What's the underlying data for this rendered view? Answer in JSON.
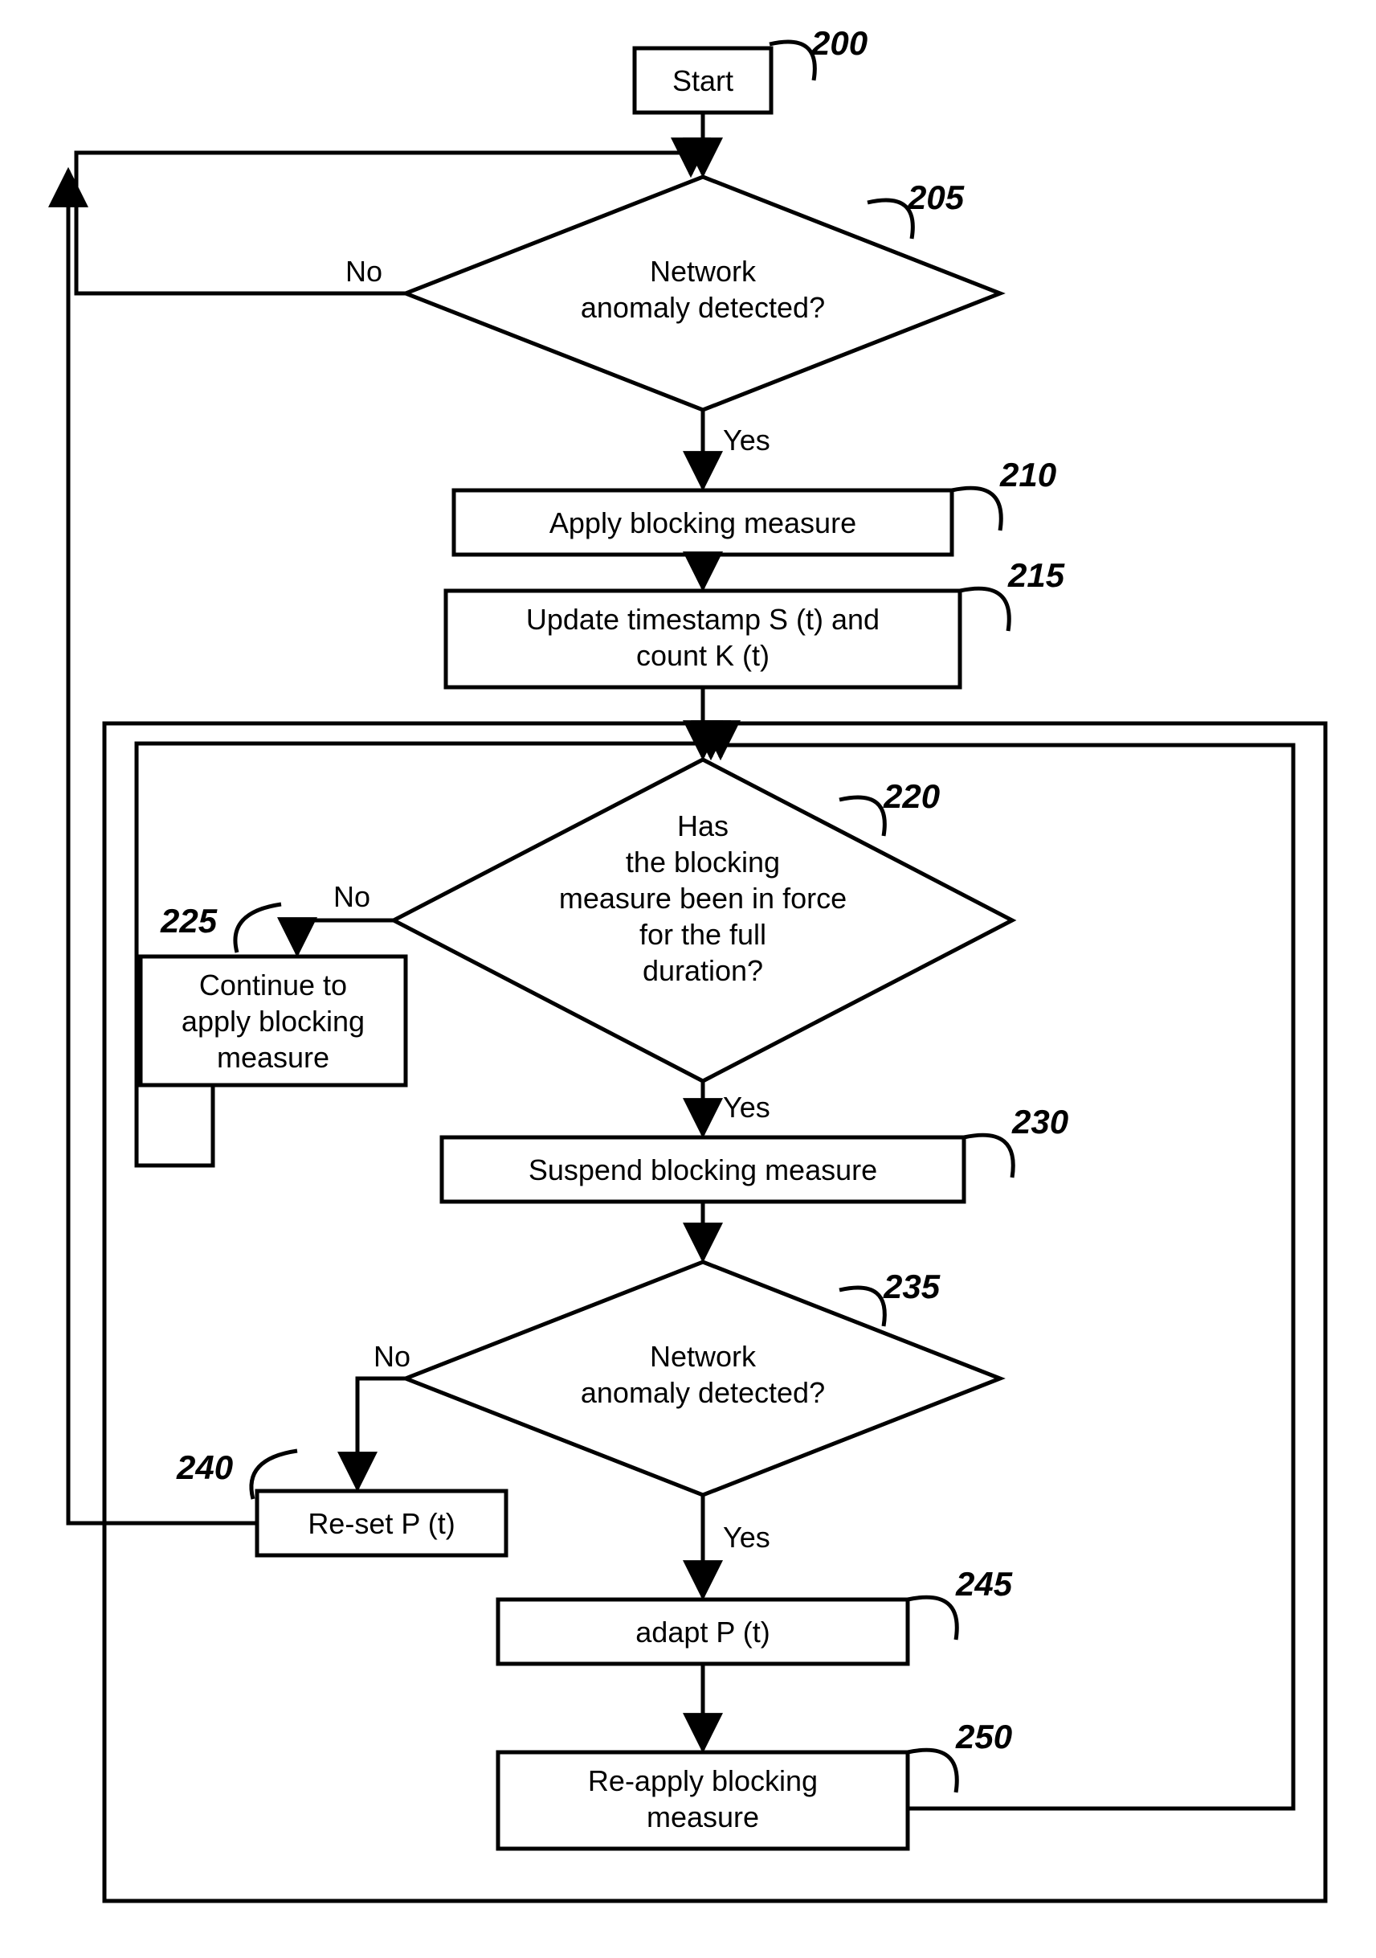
{
  "nodes": {
    "start": {
      "label": "200",
      "text": [
        "Start"
      ]
    },
    "d205": {
      "label": "205",
      "text": [
        "Network",
        "anomaly detected?"
      ]
    },
    "b210": {
      "label": "210",
      "text": [
        "Apply blocking measure"
      ]
    },
    "b215": {
      "label": "215",
      "text": [
        "Update timestamp S (t) and",
        "count K (t)"
      ]
    },
    "d220": {
      "label": "220",
      "text": [
        "Has",
        "the blocking",
        "measure been in force",
        "for the full",
        "duration?"
      ]
    },
    "b225": {
      "label": "225",
      "text": [
        "Continue to",
        "apply blocking",
        "measure"
      ]
    },
    "b230": {
      "label": "230",
      "text": [
        "Suspend blocking measure"
      ]
    },
    "d235": {
      "label": "235",
      "text": [
        "Network",
        "anomaly detected?"
      ]
    },
    "b240": {
      "label": "240",
      "text": [
        "Re-set P (t)"
      ]
    },
    "b245": {
      "label": "245",
      "text": [
        "adapt P (t)"
      ]
    },
    "b250": {
      "label": "250",
      "text": [
        "Re-apply blocking",
        "measure"
      ]
    }
  },
  "edges": {
    "d205_no": "No",
    "d205_yes": "Yes",
    "d220_no": "No",
    "d220_yes": "Yes",
    "d235_no": "No",
    "d235_yes": "Yes"
  }
}
